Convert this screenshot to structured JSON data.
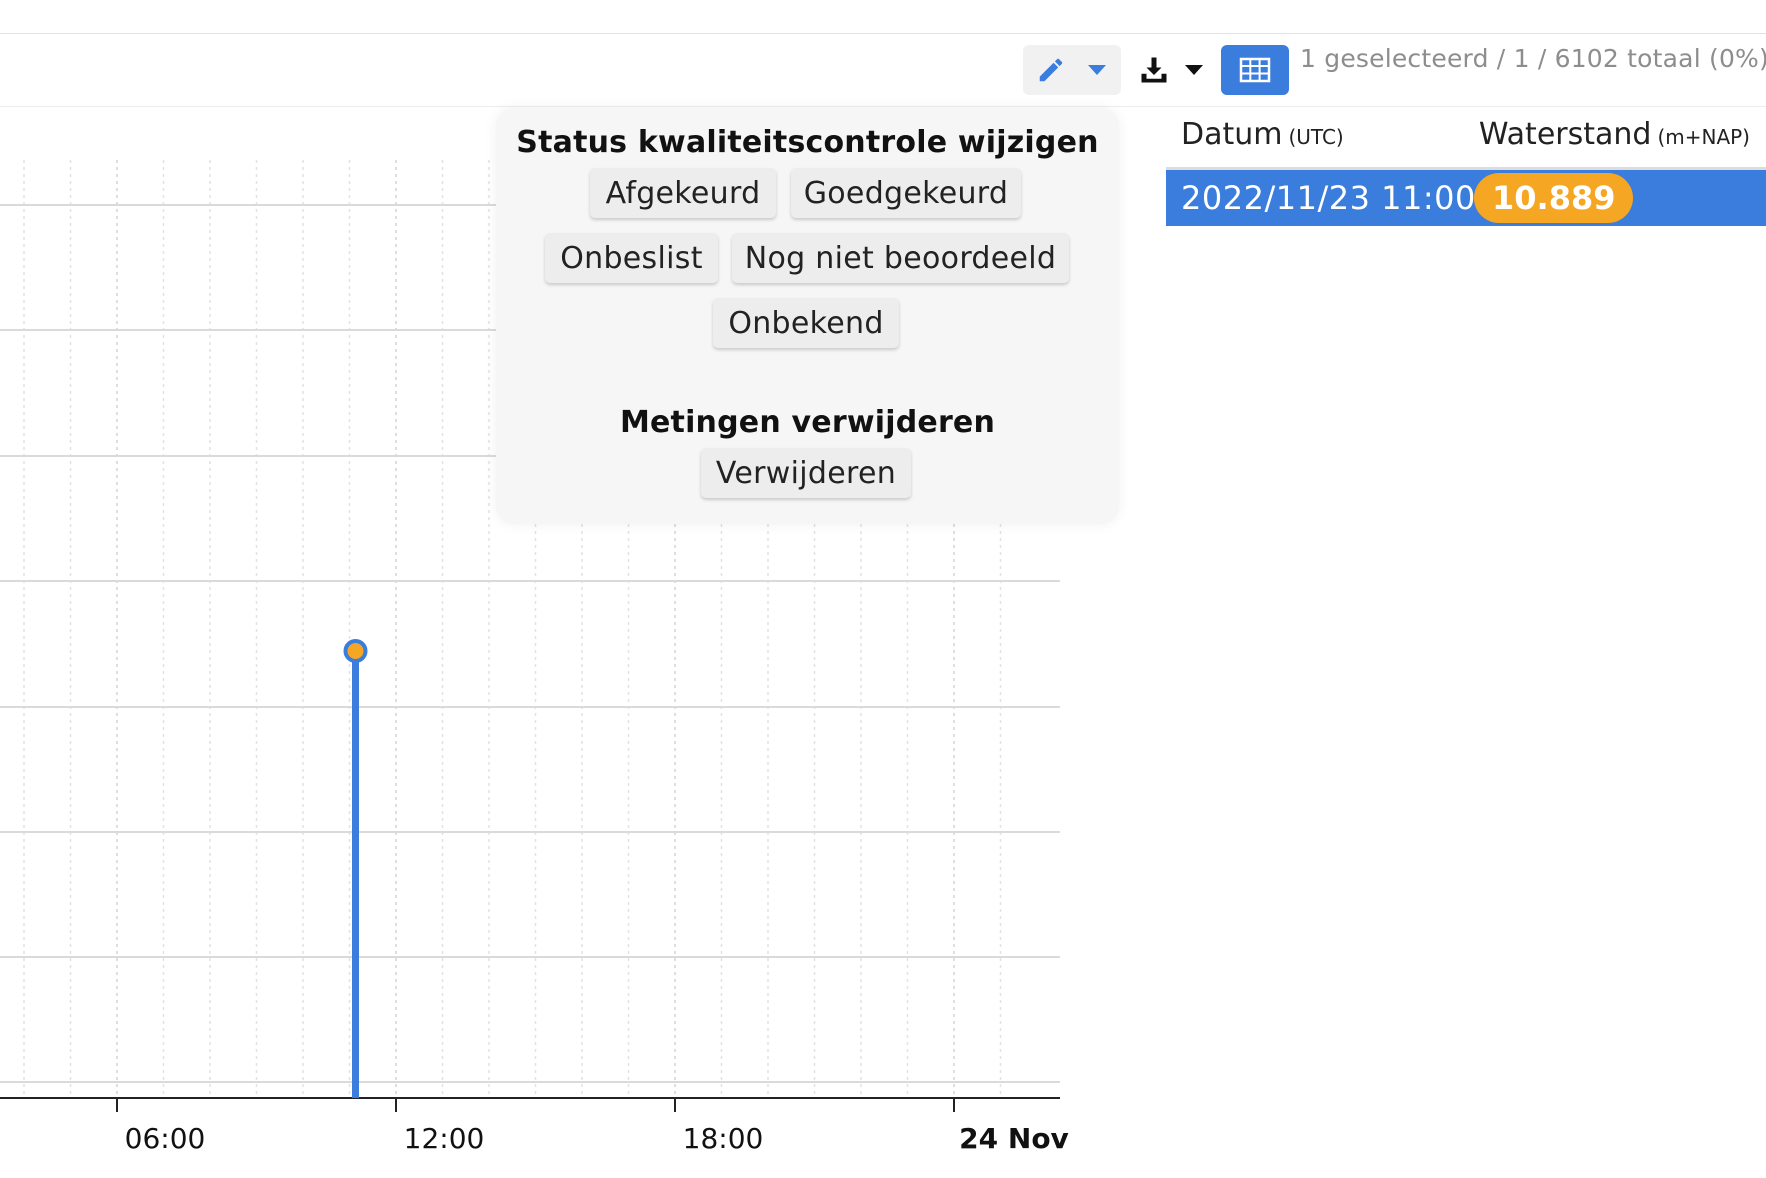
{
  "toolbar": {
    "edit_icon": "pencil-icon",
    "download_icon": "download-icon",
    "table_icon": "table-icon",
    "selection_status": "1 geselecteerd / 1 / 6102 totaal (0%)",
    "colors": {
      "accent": "#3b7ddd",
      "button_bg": "#f1f1f1"
    }
  },
  "popup": {
    "status_title": "Status kwaliteitscontrole wijzigen",
    "buttons": {
      "afgekeurd": "Afgekeurd",
      "goedgekeurd": "Goedgekeurd",
      "onbeslist": "Onbeslist",
      "nog_niet_beoordeeld": "Nog niet beoordeeld",
      "onbekend": "Onbekend"
    },
    "delete_title": "Metingen verwijderen",
    "delete_button": "Verwijderen"
  },
  "table": {
    "col_datum": "Datum",
    "col_datum_unit": "(UTC)",
    "col_waterstand": "Waterstand",
    "col_waterstand_unit": "(m+NAP)",
    "rows": [
      {
        "datum": "2022/11/23 11:00",
        "waterstand": "10.889"
      }
    ],
    "colors": {
      "selected_row": "#3b7ddd",
      "value_badge": "#f5a623"
    }
  },
  "chart_data": {
    "type": "line",
    "x_tick_labels": [
      {
        "label": "06:00",
        "hour": 6,
        "bold": false
      },
      {
        "label": "12:00",
        "hour": 12,
        "bold": false
      },
      {
        "label": "18:00",
        "hour": 18,
        "bold": false
      },
      {
        "label": "24 Nov",
        "hour": 24,
        "bold": true
      }
    ],
    "points": [
      {
        "hour": 11,
        "value": 10.889,
        "selected": true
      }
    ],
    "grid": true,
    "colors": {
      "series": "#3b7ddd",
      "selected_marker": "#f5a623"
    }
  }
}
